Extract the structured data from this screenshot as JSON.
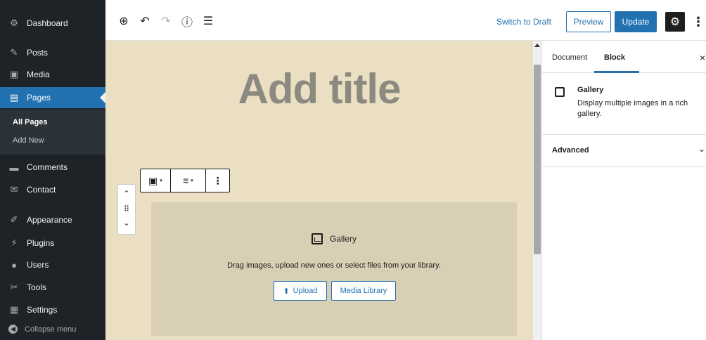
{
  "sidebar": {
    "items": [
      {
        "label": "Dashboard",
        "icon": "dashboard-icon",
        "glyph": "⚙"
      },
      {
        "label": "Posts",
        "icon": "pin-icon",
        "glyph": "✎"
      },
      {
        "label": "Media",
        "icon": "media-icon",
        "glyph": "▣"
      },
      {
        "label": "Pages",
        "icon": "pages-icon",
        "glyph": "▤"
      },
      {
        "label": "Comments",
        "icon": "comments-icon",
        "glyph": "▬"
      },
      {
        "label": "Contact",
        "icon": "mail-icon",
        "glyph": "✉"
      },
      {
        "label": "Appearance",
        "icon": "brush-icon",
        "glyph": "✐"
      },
      {
        "label": "Plugins",
        "icon": "plugin-icon",
        "glyph": "⚡"
      },
      {
        "label": "Users",
        "icon": "users-icon",
        "glyph": "●"
      },
      {
        "label": "Tools",
        "icon": "wrench-icon",
        "glyph": "✂"
      },
      {
        "label": "Settings",
        "icon": "settings-icon",
        "glyph": "▦"
      }
    ],
    "submenu": {
      "all_pages": "All Pages",
      "add_new": "Add New"
    },
    "collapse_label": "Collapse menu"
  },
  "toolbar": {
    "add_icon": "⊕",
    "undo_icon": "↶",
    "redo_icon": "↷",
    "info_icon": "ⓘ",
    "list_icon": "☰",
    "switch_to_draft": "Switch to Draft",
    "preview": "Preview",
    "update": "Update",
    "settings_glyph": "⚙",
    "more_glyph": "⋮"
  },
  "editor": {
    "title_placeholder": "Add title",
    "block_toolbar": {
      "gallery_glyph": "▣",
      "align_glyph": "≡",
      "more_glyph": "⋮",
      "caret": "▾"
    },
    "mover": {
      "up": "⌃",
      "drag": "⠿",
      "down": "⌄"
    },
    "placeholder": {
      "title": "Gallery",
      "description": "Drag images, upload new ones or select files from your library.",
      "upload": "Upload",
      "upload_glyph": "⬆",
      "media_library": "Media Library"
    }
  },
  "panel": {
    "tab_document": "Document",
    "tab_block": "Block",
    "close_glyph": "×",
    "block_name": "Gallery",
    "block_desc": "Display multiple images in a rich gallery.",
    "advanced": "Advanced",
    "chevron": "⌄"
  }
}
